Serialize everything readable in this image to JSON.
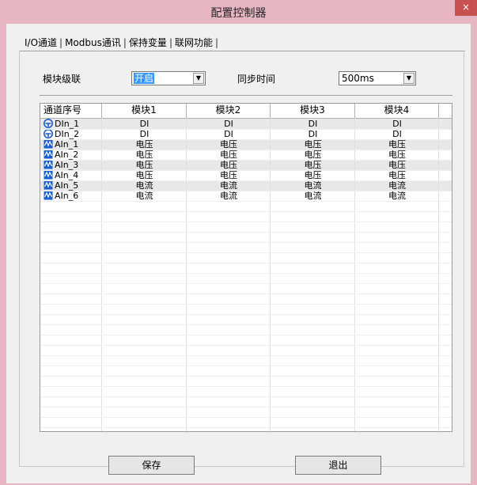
{
  "window": {
    "title": "配置控制器",
    "close_glyph": "×"
  },
  "tabs": [
    "I/O通道",
    "Modbus通讯",
    "保持变量",
    "联网功能"
  ],
  "form": {
    "cascade_label": "模块级联",
    "cascade_value": "开启",
    "sync_label": "同步时间",
    "sync_value": "500ms"
  },
  "table": {
    "headers": [
      "通道序号",
      "模块1",
      "模块2",
      "模块3",
      "模块4"
    ],
    "rows": [
      {
        "icon": "digital-input-icon",
        "name": "DIn_1",
        "cells": [
          "DI",
          "DI",
          "DI",
          "DI"
        ]
      },
      {
        "icon": "digital-input-icon",
        "name": "DIn_2",
        "cells": [
          "DI",
          "DI",
          "DI",
          "DI"
        ]
      },
      {
        "icon": "analog-input-icon",
        "name": "AIn_1",
        "cells": [
          "电压",
          "电压",
          "电压",
          "电压"
        ]
      },
      {
        "icon": "analog-input-icon",
        "name": "AIn_2",
        "cells": [
          "电压",
          "电压",
          "电压",
          "电压"
        ]
      },
      {
        "icon": "analog-input-icon",
        "name": "AIn_3",
        "cells": [
          "电压",
          "电压",
          "电压",
          "电压"
        ]
      },
      {
        "icon": "analog-input-icon",
        "name": "AIn_4",
        "cells": [
          "电压",
          "电压",
          "电压",
          "电压"
        ]
      },
      {
        "icon": "analog-input-icon",
        "name": "AIn_5",
        "cells": [
          "电流",
          "电流",
          "电流",
          "电流"
        ]
      },
      {
        "icon": "analog-input-icon",
        "name": "AIn_6",
        "cells": [
          "电流",
          "电流",
          "电流",
          "电流"
        ]
      }
    ]
  },
  "buttons": {
    "save": "保存",
    "exit": "退出"
  },
  "colors": {
    "title_bar": "#e8b6c2",
    "close_button": "#c75050",
    "selection": "#3399ff",
    "icon_blue": "#1a5fd0"
  }
}
